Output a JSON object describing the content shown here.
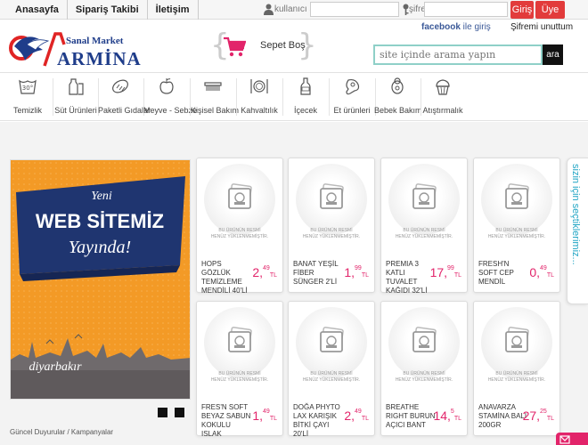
{
  "topnav": [
    {
      "label": "Anasayfa"
    },
    {
      "label": "Sipariş Takibi"
    },
    {
      "label": "İletişim"
    }
  ],
  "login": {
    "user_label": "kullanıcı adı",
    "pass_label": "şifre",
    "login_button": "Giriş",
    "register_button": "Üye Ol",
    "facebook_brand": "facebook",
    "facebook_suffix": " ile giriş",
    "forgot_password": "Şifremi unuttum"
  },
  "logo": {
    "subtitle": "Sanal Market",
    "name": "ARMİNA",
    "brand_color": "#1f3d8a"
  },
  "cart": {
    "label": "Sepet Boş"
  },
  "search": {
    "placeholder": "site içinde arama yapın",
    "button": "ara"
  },
  "categories": [
    {
      "label": "Temizlik",
      "icon": "washing-30-icon"
    },
    {
      "label": "Süt Ürünleri",
      "icon": "milk-icon"
    },
    {
      "label": "Paketli Gıdalar",
      "icon": "bread-icon"
    },
    {
      "label": "Meyve - Sebze",
      "icon": "apple-icon"
    },
    {
      "label": "Kişisel Bakım",
      "icon": "comb-icon"
    },
    {
      "label": "Kahvaltılık",
      "icon": "plate-icon"
    },
    {
      "label": "İçecek",
      "icon": "bottle-icon"
    },
    {
      "label": "Et ürünleri",
      "icon": "meat-icon"
    },
    {
      "label": "Bebek Bakım",
      "icon": "pacifier-icon"
    },
    {
      "label": "Atıştırmalık",
      "icon": "cupcake-icon"
    }
  ],
  "banner": {
    "line1": "Yeni",
    "line2": "WEB SİTEMİZ",
    "line3": "Yayında!",
    "city": "diyarbakır",
    "caption": "Güncel Duyurular / Kampanyalar"
  },
  "placeholder_text": {
    "line1": "BU ÜRÜNÜN RESMİ",
    "line2": "HENÜZ YÜKLENMEMİŞTİR."
  },
  "products": [
    {
      "name": "HOPS GÖZLÜK TEMİZLEME MENDİLİ 40'Lİ",
      "price_int": "2,",
      "price_dec": "49",
      "currency": "TL"
    },
    {
      "name": "BANAT YEŞİL FİBER SÜNGER 2'Lİ",
      "price_int": "1,",
      "price_dec": "99",
      "currency": "TL"
    },
    {
      "name": "PREMIA 3 KATLI TUVALET KAĞIDI 32'Lİ",
      "price_int": "17,",
      "price_dec": "99",
      "currency": "TL"
    },
    {
      "name": "FRESH'N SOFT CEP MENDİL",
      "price_int": "0,",
      "price_dec": "49",
      "currency": "TL"
    },
    {
      "name": "FRES'N SOFT BEYAZ SABUN KOKULU ISLAK",
      "price_int": "1,",
      "price_dec": "49",
      "currency": "TL"
    },
    {
      "name": "DOĞA PHYTO LAX KARIŞIK BİTKİ ÇAYI 20'Lİ",
      "price_int": "2,",
      "price_dec": "49",
      "currency": "TL"
    },
    {
      "name": "BREATHE RIGHT BURUN AÇICI BANT",
      "price_int": "14,",
      "price_dec": "5",
      "currency": "TL"
    },
    {
      "name": "ANAVARZA STAMİNA BALI 200GR",
      "price_int": "27,",
      "price_dec": "25",
      "currency": "TL"
    }
  ],
  "side_tab": {
    "label": "sizin için seçtiklerimiz..."
  },
  "colors": {
    "accent_red": "#e23b3b",
    "price_pink": "#e2246a",
    "search_border": "#8fd0c8",
    "side_tab_text": "#21a5c4"
  }
}
